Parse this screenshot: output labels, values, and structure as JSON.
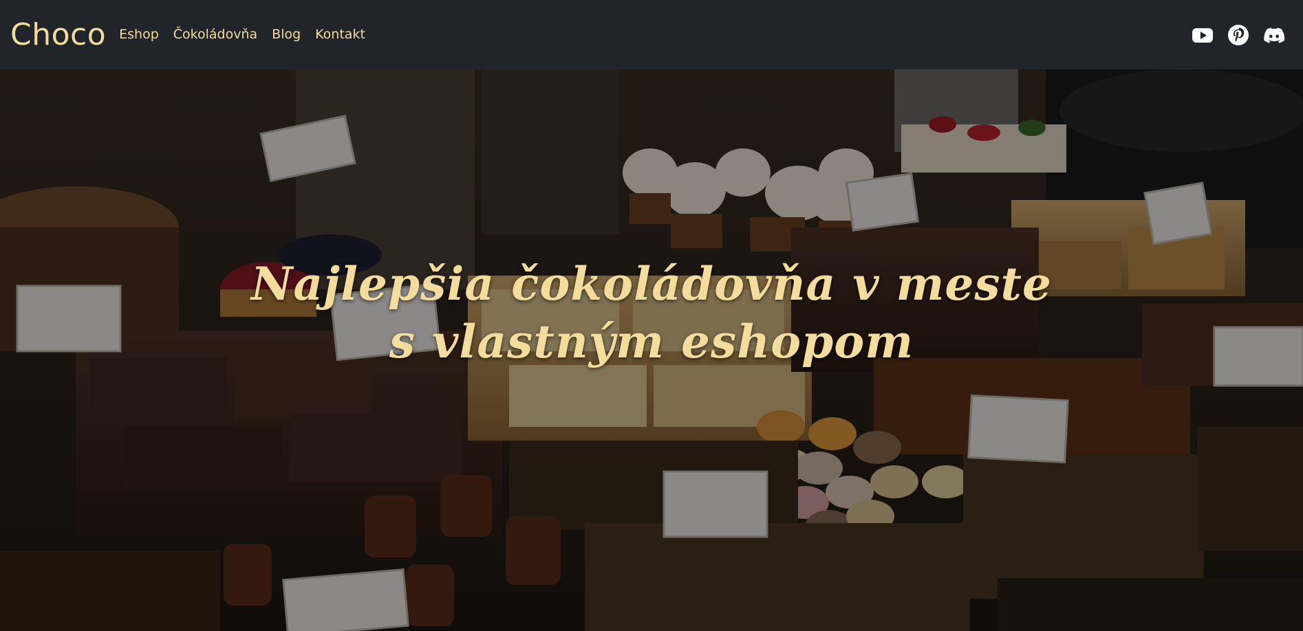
{
  "navbar": {
    "brand": "Choco",
    "links": [
      {
        "label": "Eshop"
      },
      {
        "label": "Čokoládovňa"
      },
      {
        "label": "Blog"
      },
      {
        "label": "Kontakt"
      }
    ],
    "socials": [
      {
        "icon": "youtube-icon"
      },
      {
        "icon": "pinterest-icon"
      },
      {
        "icon": "discord-icon"
      }
    ]
  },
  "hero": {
    "title_line1": "Najlepšia čokoládovňa v meste",
    "title_line2": "s vlastným eshopom",
    "background_image": "pastry display case with cakes, brownies, macarons and price cards"
  },
  "colors": {
    "navbar_bg": "#212529",
    "accent": "#f3dc9c",
    "icon": "#ffffff"
  }
}
